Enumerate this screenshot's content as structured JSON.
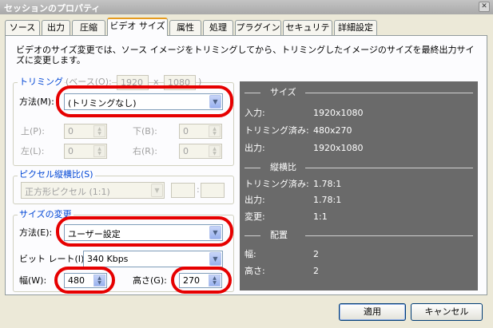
{
  "window": {
    "title": "セッションのプロパティ",
    "close_glyph": "✕"
  },
  "tabs": [
    {
      "label": "ソース"
    },
    {
      "label": "出力"
    },
    {
      "label": "圧縮"
    },
    {
      "label": "ビデオ サイズ",
      "active": true
    },
    {
      "label": "属性"
    },
    {
      "label": "処理"
    },
    {
      "label": "プラグイン"
    },
    {
      "label": "セキュリティ"
    },
    {
      "label": "詳細設定"
    }
  ],
  "description": "ビデオのサイズ変更では、ソース イメージをトリミングしてから、トリミングしたイメージのサイズを最終出力サイズに変更します。",
  "crop": {
    "title": "トリミング",
    "base_label": "(ベース(O):",
    "base_width": "1920",
    "base_x": "x",
    "base_height": "1080",
    "base_close": ")",
    "method_label": "方法(M):",
    "method_value": "(トリミングなし)",
    "top_label": "上(P):",
    "top_value": "0",
    "bottom_label": "下(B):",
    "bottom_value": "0",
    "left_label": "左(L):",
    "left_value": "0",
    "right_label": "右(R):",
    "right_value": "0"
  },
  "pixel_aspect": {
    "title": "ピクセル縦横比(S)",
    "value": "正方形ピクセル (1:1)",
    "sep": ":"
  },
  "resize": {
    "title": "サイズの変更",
    "method_label": "方法(E):",
    "method_value": "ユーザー設定",
    "bitrate_label": "ビット レート(I):",
    "bitrate_value": "340 Kbps",
    "width_label": "幅(W):",
    "width_value": "480",
    "height_label": "高さ(G):",
    "height_value": "270"
  },
  "info": {
    "size_header": "サイズ",
    "input_label": "入力:",
    "input_value": "1920x1080",
    "cropped_label": "トリミング済み:",
    "cropped_value": "480x270",
    "output_label": "出力:",
    "output_value": "1920x1080",
    "aspect_header": "縦横比",
    "aspect_cropped_label": "トリミング済み:",
    "aspect_cropped_value": "1.78:1",
    "aspect_output_label": "出力:",
    "aspect_output_value": "1.78:1",
    "change_label": "変更:",
    "change_value": "1:1",
    "layout_header": "配置",
    "layout_width_label": "幅:",
    "layout_width_value": "2",
    "layout_height_label": "高さ:",
    "layout_height_value": "2"
  },
  "buttons": {
    "apply": "適用",
    "cancel": "キャンセル"
  },
  "colors": {
    "annotation_red": "#e60000",
    "info_panel_bg": "#6a6a6a",
    "group_title_blue": "#0046d5"
  }
}
